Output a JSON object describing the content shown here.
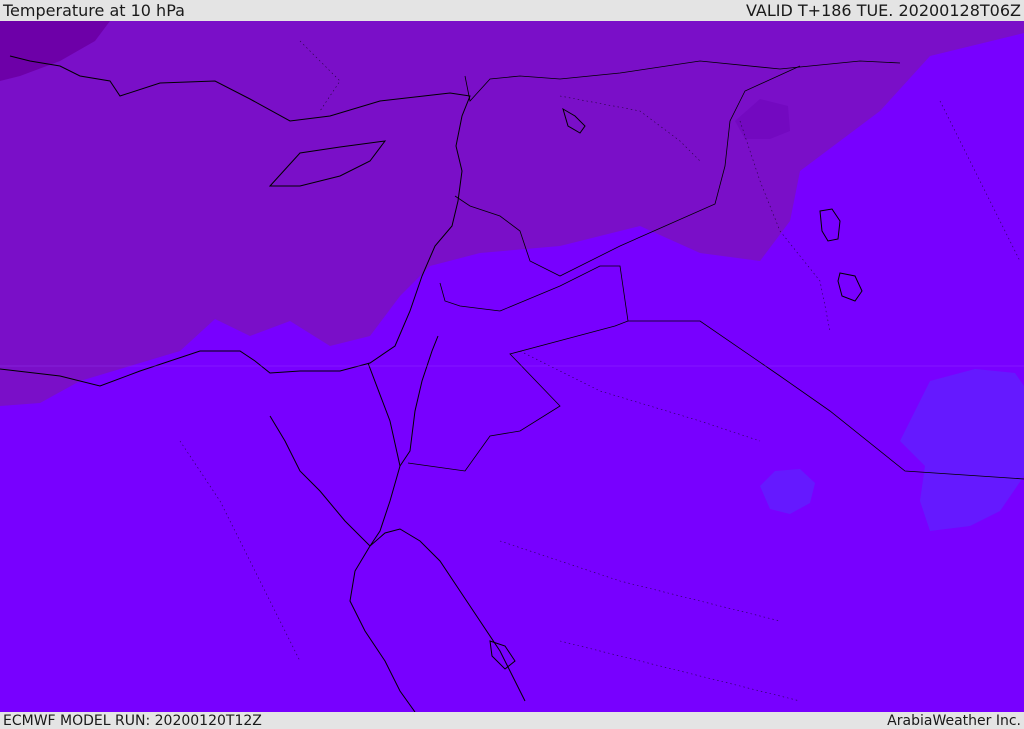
{
  "header": {
    "title": "Temperature at 10 hPa",
    "valid_time": "VALID T+186 TUE. 20200128T06Z"
  },
  "footer": {
    "model_run": "ECMWF MODEL RUN: 20200120T12Z",
    "provider": "ArabiaWeather Inc."
  },
  "colors": {
    "field_base": "#7800ff",
    "field_warm": "#7a0fc8",
    "field_warmer": "#6d00a8",
    "field_cool": "#6519ff",
    "coastline": "#000000"
  }
}
